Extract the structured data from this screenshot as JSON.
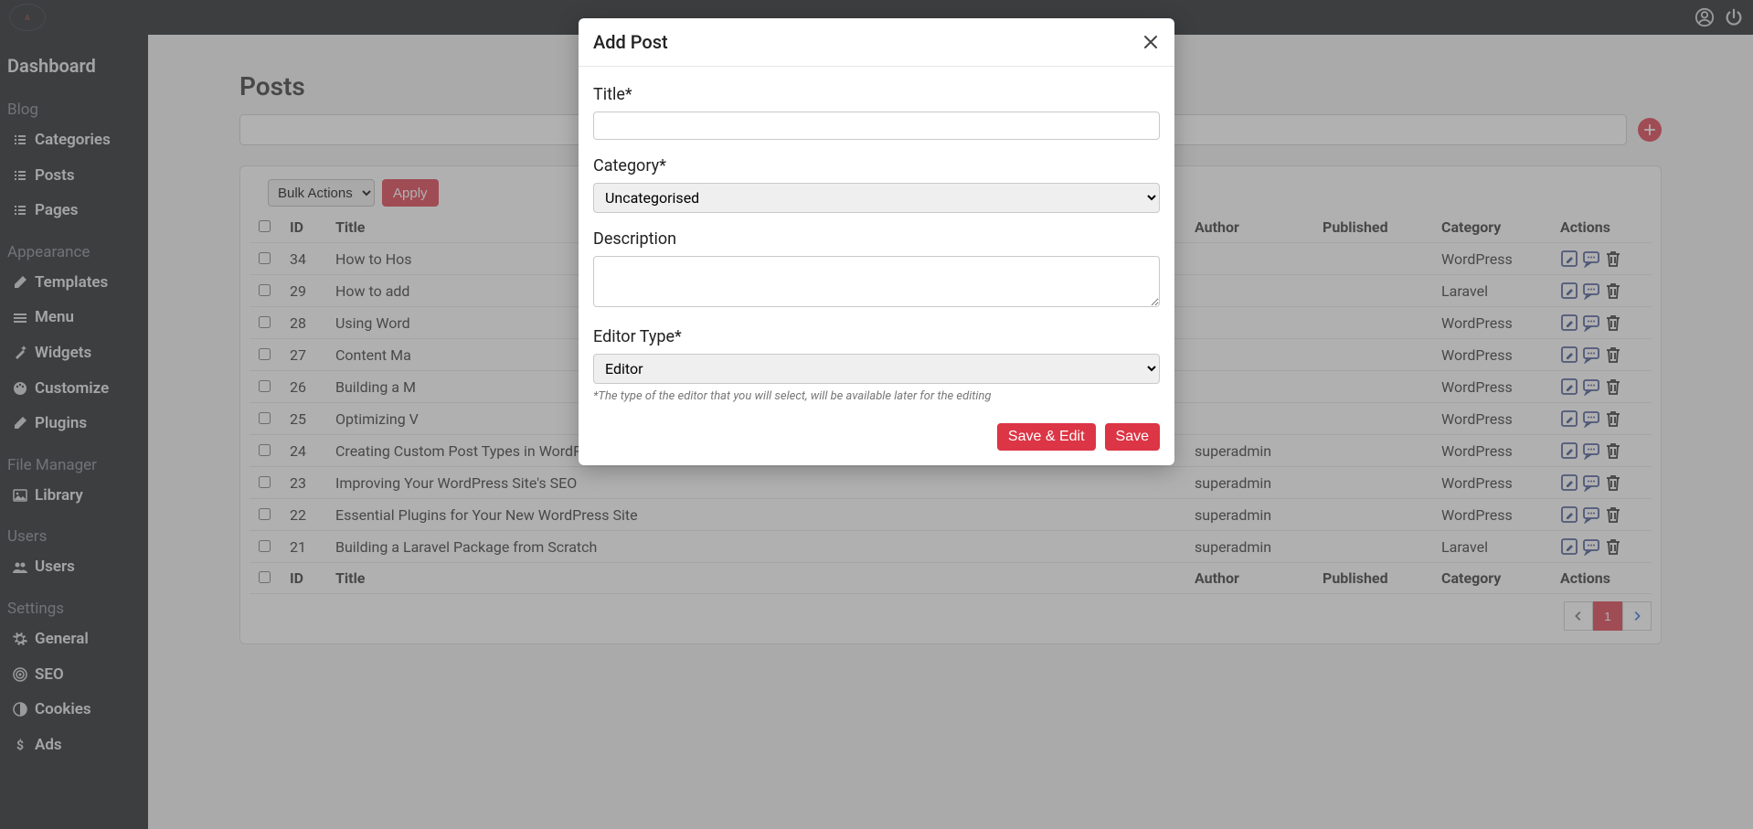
{
  "topbar": {
    "logo_text": "A"
  },
  "sidebar": {
    "dashboard": "Dashboard",
    "sections": [
      {
        "head": "Blog",
        "items": [
          {
            "label": "Categories",
            "icon": "list"
          },
          {
            "label": "Posts",
            "icon": "list"
          },
          {
            "label": "Pages",
            "icon": "list"
          }
        ]
      },
      {
        "head": "Appearance",
        "items": [
          {
            "label": "Templates",
            "icon": "pen"
          },
          {
            "label": "Menu",
            "icon": "menu"
          },
          {
            "label": "Widgets",
            "icon": "magic"
          },
          {
            "label": "Customize",
            "icon": "palette"
          },
          {
            "label": "Plugins",
            "icon": "pen"
          }
        ]
      },
      {
        "head": "File Manager",
        "items": [
          {
            "label": "Library",
            "icon": "image"
          }
        ]
      },
      {
        "head": "Users",
        "items": [
          {
            "label": "Users",
            "icon": "users"
          }
        ]
      },
      {
        "head": "Settings",
        "items": [
          {
            "label": "General",
            "icon": "gear"
          },
          {
            "label": "SEO",
            "icon": "target"
          },
          {
            "label": "Cookies",
            "icon": "contrast"
          },
          {
            "label": "Ads",
            "icon": "dollar"
          }
        ]
      }
    ]
  },
  "page": {
    "title": "Posts",
    "bulk_placeholder": "Bulk Actions",
    "apply_label": "Apply"
  },
  "table": {
    "headers": {
      "id": "ID",
      "title": "Title",
      "author": "Author",
      "published": "Published",
      "category": "Category",
      "actions": "Actions"
    },
    "rows": [
      {
        "id": "34",
        "title": "How to Hos",
        "author": "",
        "published": "",
        "category": "WordPress"
      },
      {
        "id": "29",
        "title": "How to add",
        "author": "",
        "published": "",
        "category": "Laravel"
      },
      {
        "id": "28",
        "title": "Using Word",
        "author": "",
        "published": "",
        "category": "WordPress"
      },
      {
        "id": "27",
        "title": "Content Ma",
        "author": "",
        "published": "",
        "category": "WordPress"
      },
      {
        "id": "26",
        "title": "Building a M",
        "author": "",
        "published": "",
        "category": "WordPress"
      },
      {
        "id": "25",
        "title": "Optimizing V",
        "author": "",
        "published": "",
        "category": "WordPress"
      },
      {
        "id": "24",
        "title": "Creating Custom Post Types in WordPress",
        "author": "superadmin",
        "published": "",
        "category": "WordPress"
      },
      {
        "id": "23",
        "title": "Improving Your WordPress Site's SEO",
        "author": "superadmin",
        "published": "",
        "category": "WordPress"
      },
      {
        "id": "22",
        "title": "Essential Plugins for Your New WordPress Site",
        "author": "superadmin",
        "published": "",
        "category": "WordPress"
      },
      {
        "id": "21",
        "title": "Building a Laravel Package from Scratch",
        "author": "superadmin",
        "published": "",
        "category": "Laravel"
      }
    ]
  },
  "pagination": {
    "current": "1"
  },
  "modal": {
    "title": "Add Post",
    "fields": {
      "title_label": "Title*",
      "category_label": "Category*",
      "category_value": "Uncategorised",
      "description_label": "Description",
      "editor_type_label": "Editor Type*",
      "editor_type_value": "Editor",
      "editor_helper": "*The type of the editor that you will select, will be available later for the editing"
    },
    "buttons": {
      "save_edit": "Save & Edit",
      "save": "Save"
    }
  }
}
